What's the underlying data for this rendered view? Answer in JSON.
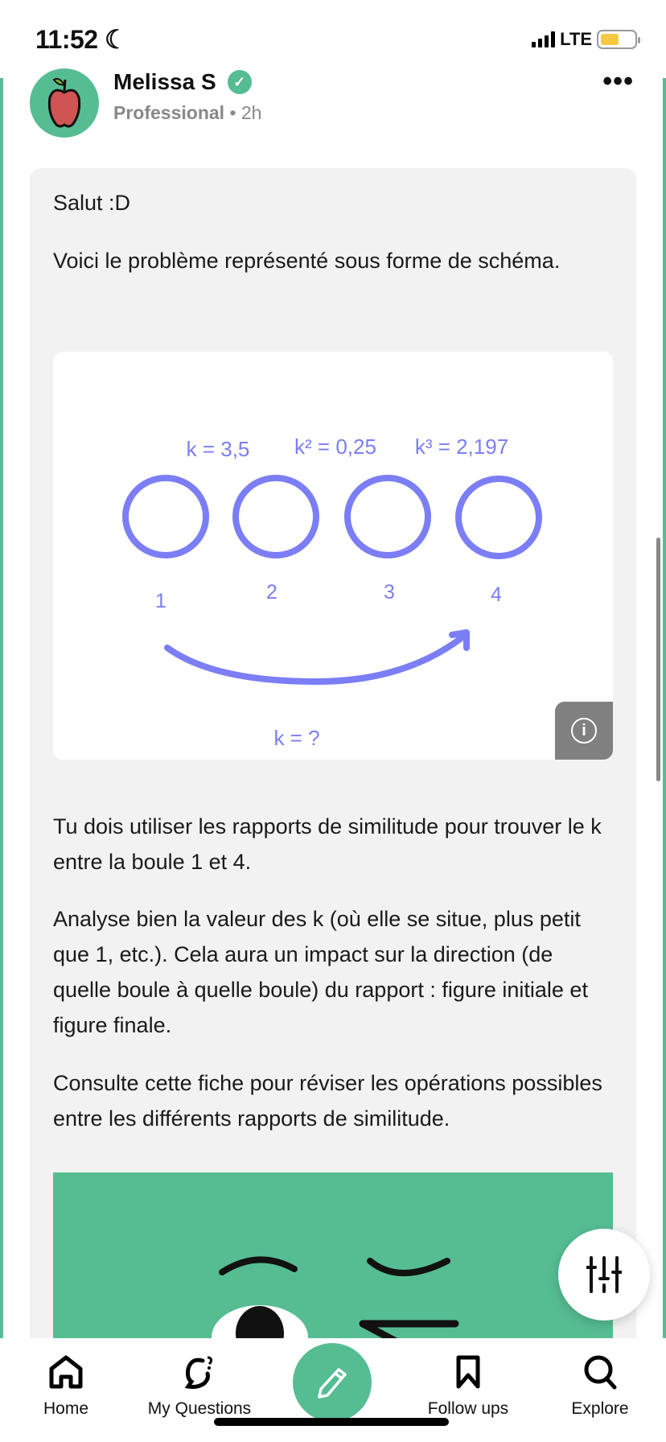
{
  "status_bar": {
    "time": "11:52",
    "network": "LTE",
    "battery_level": 0.55,
    "battery_color": "#f6c944"
  },
  "post": {
    "author": "Melissa S",
    "verified": true,
    "role": "Professional",
    "separator": "•",
    "time_ago": "2h",
    "more_label": "•••",
    "paragraphs": [
      "Salut :D",
      "Voici le problème représenté sous forme de schéma.",
      "Tu dois utiliser les rapports de similitude pour trouver le k entre la boule 1 et 4.",
      "Analyse bien la valeur des k (où elle se situe, plus petit que 1, etc.). Cela aura un impact sur la direction (de quelle boule à quelle boule) du rapport : figure initiale et figure finale.",
      "Consulte cette fiche pour réviser les opérations possibles entre les différents rapports de similitude."
    ],
    "diagram": {
      "ratios": [
        "k = 3,5",
        "k² = 0,25",
        "k³ = 2,197"
      ],
      "ball_labels": [
        "1",
        "2",
        "3",
        "4"
      ],
      "question": "k = ?",
      "info_icon": "info-icon",
      "color": "#7b7ef5"
    }
  },
  "fab": {
    "icon": "sliders-icon"
  },
  "nav": {
    "items": [
      {
        "label": "Home",
        "icon": "home-icon"
      },
      {
        "label": "My Questions",
        "icon": "question-bubble-icon"
      },
      {
        "label": "",
        "icon": "pencil-icon"
      },
      {
        "label": "Follow ups",
        "icon": "bookmark-icon"
      },
      {
        "label": "Explore",
        "icon": "search-icon"
      }
    ]
  },
  "colors": {
    "brand": "#56bd93",
    "card_bg": "#f2f2f2"
  }
}
